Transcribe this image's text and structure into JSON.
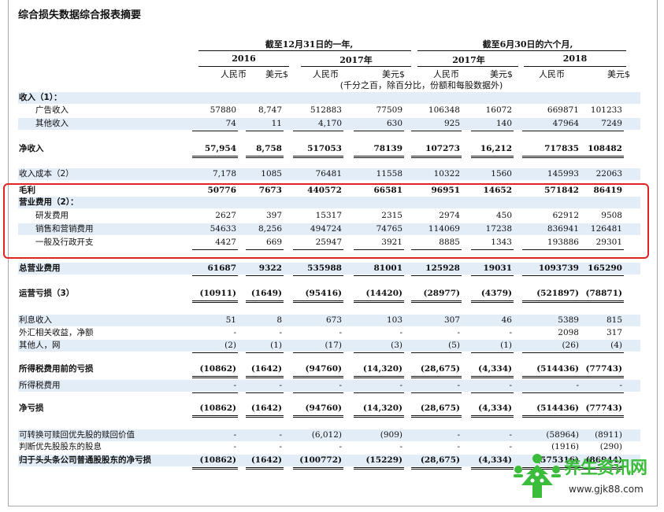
{
  "title": "综合损失数据综合报表摘要",
  "header": {
    "period1": "截至12月31日的一年,",
    "period2": "截至6月30日的六个月,",
    "years": [
      "2016",
      "2017年",
      "2017年",
      "2018"
    ],
    "currencies": [
      "人民币",
      "美元$",
      "人民币",
      "美元$",
      "人民币",
      "美元$",
      "人民币",
      "美元$"
    ],
    "note": "(千分之百，除百分比，份额和每股数据外)"
  },
  "rows": [
    {
      "label": "收入（1）：",
      "indent": 0,
      "bold": true,
      "shaded": true,
      "values": []
    },
    {
      "label": "广告收入",
      "indent": 1,
      "bold": false,
      "shaded": false,
      "values": [
        "57880",
        "8,747",
        "512883",
        "77509",
        "106348",
        "16072",
        "669871",
        "101233"
      ]
    },
    {
      "label": "其他收入",
      "indent": 1,
      "bold": false,
      "shaded": true,
      "values": [
        "74",
        "11",
        "4,170",
        "630",
        "925",
        "140",
        "47964",
        "7249"
      ]
    },
    {
      "label": "净收入",
      "indent": 0,
      "bold": true,
      "shaded": false,
      "values": [
        "57,954",
        "8,758",
        "517053",
        "78139",
        "107273",
        "16,212",
        "717835",
        "108482"
      ]
    },
    {
      "label": "收入成本（2）",
      "indent": 0,
      "bold": false,
      "shaded": true,
      "values": [
        "7,178",
        "1085",
        "76481",
        "11558",
        "10322",
        "1560",
        "145993",
        "22063"
      ]
    },
    {
      "label": "毛利",
      "indent": 0,
      "bold": true,
      "shaded": false,
      "values": [
        "50776",
        "7673",
        "440572",
        "66581",
        "96951",
        "14652",
        "571842",
        "86419"
      ]
    },
    {
      "label": "营业费用（2）：",
      "indent": 0,
      "bold": true,
      "shaded": true,
      "values": []
    },
    {
      "label": "研发费用",
      "indent": 1,
      "bold": false,
      "shaded": false,
      "values": [
        "2627",
        "397",
        "15317",
        "2315",
        "2974",
        "450",
        "62912",
        "9508"
      ]
    },
    {
      "label": "销售和营销费用",
      "indent": 1,
      "bold": false,
      "shaded": true,
      "values": [
        "54633",
        "8,256",
        "494724",
        "74765",
        "114069",
        "17238",
        "836941",
        "126481"
      ]
    },
    {
      "label": "一般及行政开支",
      "indent": 1,
      "bold": false,
      "shaded": false,
      "values": [
        "4427",
        "669",
        "25947",
        "3921",
        "8885",
        "1343",
        "193886",
        "29301"
      ]
    },
    {
      "label": "总营业费用",
      "indent": 0,
      "bold": true,
      "shaded": true,
      "values": [
        "61687",
        "9322",
        "535988",
        "81001",
        "125928",
        "19031",
        "1093739",
        "165290"
      ]
    },
    {
      "label": "运营亏损（3）",
      "indent": 0,
      "bold": true,
      "shaded": false,
      "values": [
        "(10911)",
        "(1649)",
        "(95416)",
        "(14420)",
        "(28977)",
        "(4379)",
        "(521897)",
        "(78871)"
      ]
    },
    {
      "label": "利息收入",
      "indent": 0,
      "bold": false,
      "shaded": true,
      "values": [
        "51",
        "8",
        "673",
        "103",
        "307",
        "46",
        "5389",
        "815"
      ]
    },
    {
      "label": "外汇相关收益，净额",
      "indent": 0,
      "bold": false,
      "shaded": false,
      "values": [
        "-",
        "-",
        "-",
        "-",
        "-",
        "-",
        "2098",
        "317"
      ]
    },
    {
      "label": "其他人，网",
      "indent": 0,
      "bold": false,
      "shaded": true,
      "values": [
        "(2)",
        "(1)",
        "(17)",
        "(3)",
        "(5)",
        "(1)",
        "(26)",
        "(4)"
      ]
    },
    {
      "label": "所得税费用前的亏损",
      "indent": 0,
      "bold": true,
      "shaded": false,
      "values": [
        "(10862)",
        "(1642)",
        "(94760)",
        "(14,320)",
        "(28,675)",
        "(4,334)",
        "(514436)",
        "(77743)"
      ]
    },
    {
      "label": "所得税费用",
      "indent": 0,
      "bold": false,
      "shaded": true,
      "values": [
        "-",
        "-",
        "-",
        "-",
        "-",
        "-",
        "-",
        "-"
      ]
    },
    {
      "label": "净亏损",
      "indent": 0,
      "bold": true,
      "shaded": false,
      "values": [
        "(10862)",
        "(1642)",
        "(94760)",
        "(14,320)",
        "(28,675)",
        "(4,334)",
        "(514436)",
        "(77743)"
      ]
    },
    {
      "label": "可转换可赎回优先股的赎回价值",
      "indent": 0,
      "bold": false,
      "shaded": true,
      "values": [
        "-",
        "-",
        "(6,012)",
        "(909)",
        "-",
        "-",
        "(58964)",
        "(8911)"
      ]
    },
    {
      "label": "判断优先股股东的股息",
      "indent": 0,
      "bold": false,
      "shaded": false,
      "values": [
        "-",
        "-",
        "-",
        "-",
        "-",
        "-",
        "(1916)",
        "(290)"
      ]
    },
    {
      "label": "归于头头条公司普通股股东的净亏损",
      "indent": 0,
      "bold": true,
      "shaded": true,
      "values": [
        "(10862)",
        "(1642)",
        "(100772)",
        "(15229)",
        "(28,675)",
        "(4,334)",
        "(575316)",
        "(86944)"
      ]
    }
  ],
  "watermark": {
    "brand": "养生资讯网",
    "url": "www.gjk88.com"
  }
}
